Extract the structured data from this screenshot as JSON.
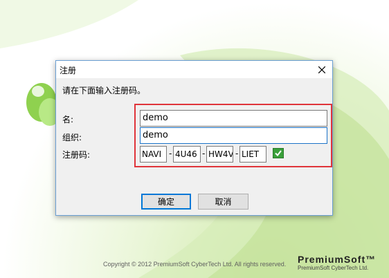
{
  "splash": {
    "copyright": "Copyright © 2012 PremiumSoft CyberTech Ltd. All rights reserved.",
    "brand_prefix": "PremiumSoft",
    "brand_suffix": "™",
    "brand_sub": "PremiumSoft CyberTech Ltd."
  },
  "dialog": {
    "title": "注册",
    "instruction": "请在下面输入注册码。",
    "labels": {
      "name": "名:",
      "organization": "组织:",
      "reg_code": "注册码:"
    },
    "fields": {
      "name": "demo",
      "organization": "demo",
      "code_parts": [
        "NAVI",
        "4U46",
        "HW4V",
        "LIET"
      ],
      "separator": "-"
    },
    "buttons": {
      "ok": "确定",
      "cancel": "取消"
    },
    "colors": {
      "highlight_box": "#e0343a",
      "check_green": "#3aa03a",
      "focus_border": "#1a73c8"
    }
  }
}
